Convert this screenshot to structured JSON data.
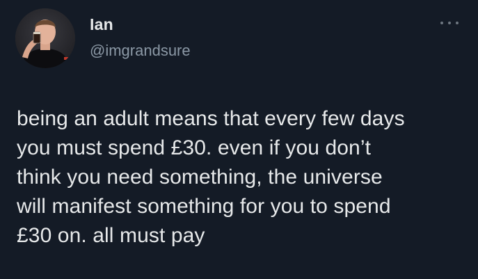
{
  "author": {
    "display_name": "Ian",
    "handle": "@imgrandsure",
    "avatar_icon": "profile-photo"
  },
  "more_icon": "more-horizontal-icon",
  "tweet": {
    "text": "being an adult means that every few days\nyou must spend £30. even if you don’t\nthink you need something, the universe\nwill manifest something for you to spend\n£30 on. all must pay"
  },
  "colors": {
    "background": "#141b26",
    "primary_text": "#e7e9ea",
    "secondary_text": "#8b98a5"
  }
}
